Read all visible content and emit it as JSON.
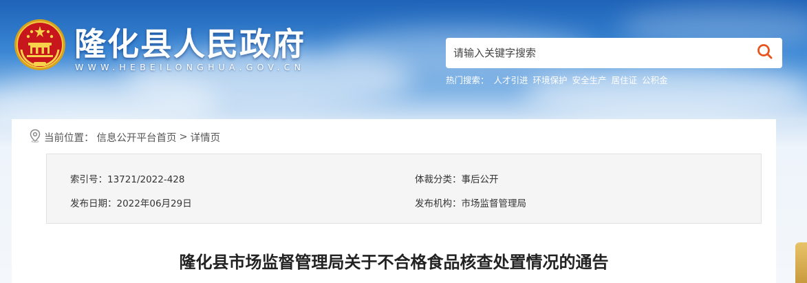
{
  "header": {
    "site_title": "隆化县人民政府",
    "site_url": "WWW.HEBEILONGHUA.GOV.CN",
    "emblem_icon": "national-emblem-icon"
  },
  "search": {
    "placeholder": "请输入关键字搜索",
    "icon": "search-icon",
    "accent_color": "#e8541e"
  },
  "hot_search": {
    "label": "热门搜索：",
    "items": [
      "人才引进",
      "环境保护",
      "安全生产",
      "居住证",
      "公积金"
    ]
  },
  "breadcrumb": {
    "icon": "location-pin-icon",
    "prefix": "当前位置：",
    "home": "信息公开平台首页",
    "separator": ">",
    "current": "详情页"
  },
  "meta": {
    "index_label": "索引号：",
    "index_value": "13721/2022-428",
    "category_label": "体裁分类：",
    "category_value": "事后公开",
    "date_label": "发布日期：",
    "date_value": "2022年06月29日",
    "org_label": "发布机构：",
    "org_value": "市场监督管理局"
  },
  "article": {
    "title": "隆化县市场监督管理局关于不合格食品核查处置情况的通告"
  }
}
